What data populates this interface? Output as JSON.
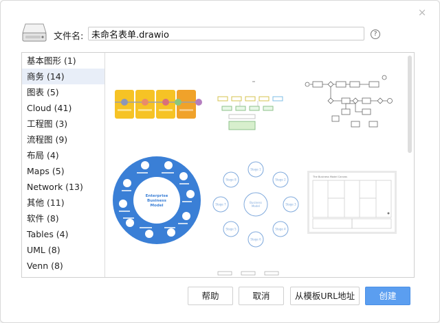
{
  "dialog": {
    "close_glyph": "×",
    "filename_label": "文件名:",
    "filename_value": "未命名表单.drawio",
    "help_glyph": "?"
  },
  "categories": [
    {
      "label": "基本图形 (1)",
      "active": false
    },
    {
      "label": "商务 (14)",
      "active": true
    },
    {
      "label": "图表 (5)",
      "active": false
    },
    {
      "label": "Cloud (41)",
      "active": false
    },
    {
      "label": "工程图 (3)",
      "active": false
    },
    {
      "label": "流程图 (9)",
      "active": false
    },
    {
      "label": "布局 (4)",
      "active": false
    },
    {
      "label": "Maps (5)",
      "active": false
    },
    {
      "label": "Network (13)",
      "active": false
    },
    {
      "label": "其他 (11)",
      "active": false
    },
    {
      "label": "软件 (8)",
      "active": false
    },
    {
      "label": "Tables (4)",
      "active": false
    },
    {
      "label": "UML (8)",
      "active": false
    },
    {
      "label": "Venn (8)",
      "active": false
    }
  ],
  "templates": {
    "ebm_title": "Enterprise Business Model",
    "ebm_segments": [
      "Global Partnerships",
      "Environmental Awareness",
      "Finance",
      "Digital Development",
      "Customer Service",
      "Infrastructure",
      "Technology Community",
      "Sustainability",
      "Content Management System",
      "Marketing Group"
    ],
    "cycle_center": "Business Model",
    "cycle_stages": [
      "Stage 1",
      "Stage 2",
      "Stage 3",
      "Stage 4",
      "Stage 5",
      "Stage 6",
      "Stage 7",
      "Stage 8"
    ],
    "canvas_title": "The Business Model Canvas"
  },
  "footer": {
    "help": "帮助",
    "cancel": "取消",
    "from_url": "从模板URL地址",
    "create": "创建"
  },
  "colors": {
    "accent": "#5b9ef0",
    "ebm_blue": "#3a7fd6",
    "roadmap_yellow": "#f6c325",
    "roadmap_orange": "#f0a22a"
  }
}
